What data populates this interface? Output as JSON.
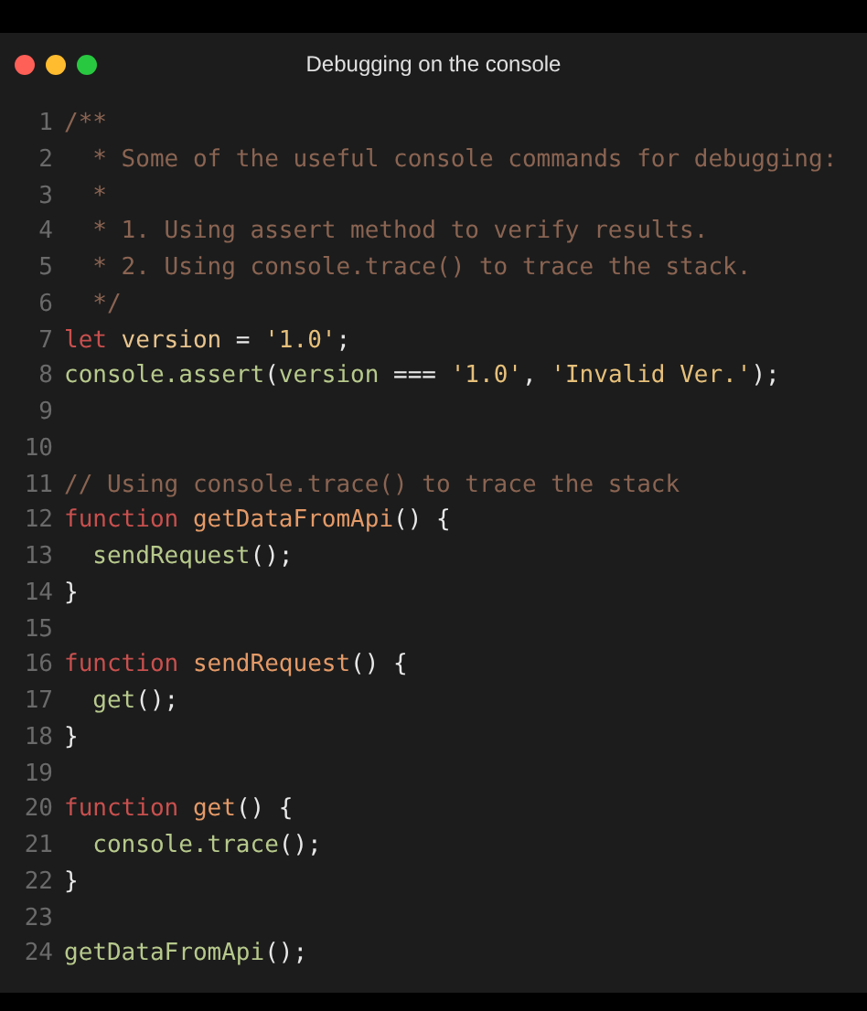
{
  "window": {
    "title": "Debugging on the console"
  },
  "code_lines": [
    {
      "number": "1",
      "tokens": [
        {
          "kind": "comment",
          "text": "/**"
        }
      ]
    },
    {
      "number": "2",
      "tokens": [
        {
          "kind": "comment",
          "text": "  * Some of the useful console commands for debugging:"
        }
      ]
    },
    {
      "number": "3",
      "tokens": [
        {
          "kind": "comment",
          "text": "  *"
        }
      ]
    },
    {
      "number": "4",
      "tokens": [
        {
          "kind": "comment",
          "text": "  * 1. Using assert method to verify results."
        }
      ]
    },
    {
      "number": "5",
      "tokens": [
        {
          "kind": "comment",
          "text": "  * 2. Using console.trace() to trace the stack."
        }
      ]
    },
    {
      "number": "6",
      "tokens": [
        {
          "kind": "comment",
          "text": "  */"
        }
      ]
    },
    {
      "number": "7",
      "tokens": [
        {
          "kind": "keyword",
          "text": "let"
        },
        {
          "kind": "variable",
          "text": " version"
        },
        {
          "kind": "plain",
          "text": " = "
        },
        {
          "kind": "string",
          "text": "'1.0'"
        },
        {
          "kind": "plain",
          "text": ";"
        }
      ]
    },
    {
      "number": "8",
      "tokens": [
        {
          "kind": "call",
          "text": "console.assert"
        },
        {
          "kind": "plain",
          "text": "("
        },
        {
          "kind": "call",
          "text": "version"
        },
        {
          "kind": "plain",
          "text": " === "
        },
        {
          "kind": "string",
          "text": "'1.0'"
        },
        {
          "kind": "plain",
          "text": ", "
        },
        {
          "kind": "string",
          "text": "'Invalid Ver.'"
        },
        {
          "kind": "plain",
          "text": ");"
        }
      ]
    },
    {
      "number": "9"
    },
    {
      "number": "10"
    },
    {
      "number": "11",
      "tokens": [
        {
          "kind": "comment",
          "text": "// Using console.trace() to trace the stack"
        }
      ]
    },
    {
      "number": "12",
      "tokens": [
        {
          "kind": "keyword",
          "text": "function"
        },
        {
          "kind": "function",
          "text": " getDataFromApi"
        },
        {
          "kind": "plain",
          "text": "() {"
        }
      ]
    },
    {
      "number": "13",
      "tokens": [
        {
          "kind": "call",
          "text": "  sendRequest"
        },
        {
          "kind": "plain",
          "text": "();"
        }
      ]
    },
    {
      "number": "14",
      "tokens": [
        {
          "kind": "plain",
          "text": "}"
        }
      ]
    },
    {
      "number": "15"
    },
    {
      "number": "16",
      "tokens": [
        {
          "kind": "keyword",
          "text": "function"
        },
        {
          "kind": "function",
          "text": " sendRequest"
        },
        {
          "kind": "plain",
          "text": "() {"
        }
      ]
    },
    {
      "number": "17",
      "tokens": [
        {
          "kind": "call",
          "text": "  get"
        },
        {
          "kind": "plain",
          "text": "();"
        }
      ]
    },
    {
      "number": "18",
      "tokens": [
        {
          "kind": "plain",
          "text": "}"
        }
      ]
    },
    {
      "number": "19"
    },
    {
      "number": "20",
      "tokens": [
        {
          "kind": "keyword",
          "text": "function"
        },
        {
          "kind": "function",
          "text": " get"
        },
        {
          "kind": "plain",
          "text": "() {"
        }
      ]
    },
    {
      "number": "21",
      "tokens": [
        {
          "kind": "call",
          "text": "  console.trace"
        },
        {
          "kind": "plain",
          "text": "();"
        }
      ]
    },
    {
      "number": "22",
      "tokens": [
        {
          "kind": "plain",
          "text": "}"
        }
      ]
    },
    {
      "number": "23"
    },
    {
      "number": "24",
      "tokens": [
        {
          "kind": "call",
          "text": "getDataFromApi"
        },
        {
          "kind": "plain",
          "text": "();"
        }
      ]
    }
  ]
}
